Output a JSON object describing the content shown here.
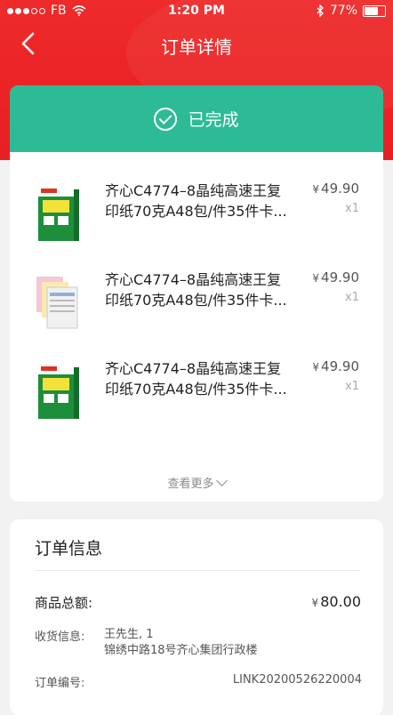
{
  "status_bar": {
    "carrier": "FB",
    "time": "1:20 PM",
    "battery": "77%",
    "battery_level": 0.77
  },
  "nav": {
    "title": "订单详情"
  },
  "order_status": {
    "text": "已完成",
    "color": "#2dbb97"
  },
  "products": [
    {
      "name": "齐心C4774–8晶纯高速王复\n印纸70克A48包/件35件卡...",
      "price": "49.90",
      "currency": "¥",
      "qty": "x1",
      "thumb": "green-paper-pack"
    },
    {
      "name": "齐心C4774–8晶纯高速王复\n印纸70克A48包/件35件卡...",
      "price": "49.90",
      "currency": "¥",
      "qty": "x1",
      "thumb": "multicolor-form-paper"
    },
    {
      "name": "齐心C4774–8晶纯高速王复\n印纸70克A48包/件35件卡...",
      "price": "49.90",
      "currency": "¥",
      "qty": "x1",
      "thumb": "green-paper-pack"
    }
  ],
  "view_more": "查看更多",
  "order_info": {
    "title": "订单信息",
    "total_label": "商品总额:",
    "total_currency": "¥",
    "total_value": "80.00",
    "address_label": "收货信息:",
    "address_text": "王先生, 1\n锦绣中路18号齐心集团行政楼",
    "order_no_label": "订单编号:",
    "order_no": "LINK20200526220004"
  },
  "colors": {
    "header_red": "#e81f23",
    "status_green": "#2dbb97"
  }
}
